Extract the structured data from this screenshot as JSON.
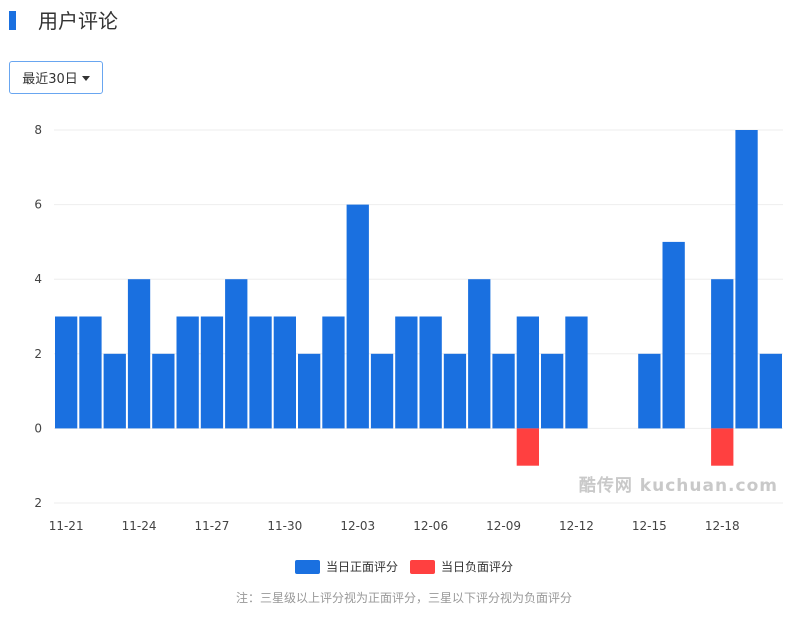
{
  "header": {
    "title": "用户评论"
  },
  "range_button": {
    "label": "最近30日",
    "icon": "caret-down-icon"
  },
  "colors": {
    "accent": "#1a70e0",
    "positive": "#1a70e0",
    "negative": "#ff4040",
    "grid": "#eeeeee"
  },
  "watermark": "酷传网 kuchuan.com",
  "legend": [
    {
      "label": "当日正面评分",
      "color": "#1a70e0"
    },
    {
      "label": "当日负面评分",
      "color": "#ff4040"
    }
  ],
  "note": "注：三星级以上评分视为正面评分，三星以下评分视为负面评分",
  "chart_data": {
    "type": "bar",
    "x": [
      "11-21",
      "11-22",
      "11-23",
      "11-24",
      "11-25",
      "11-26",
      "11-27",
      "11-28",
      "11-29",
      "11-30",
      "12-01",
      "12-02",
      "12-03",
      "12-04",
      "12-05",
      "12-06",
      "12-07",
      "12-08",
      "12-09",
      "12-10",
      "12-11",
      "12-12",
      "12-13",
      "12-14",
      "12-15",
      "12-16",
      "12-17",
      "12-18",
      "12-19",
      "12-20"
    ],
    "x_tick_labels": [
      "11-21",
      "11-24",
      "11-27",
      "11-30",
      "12-03",
      "12-06",
      "12-09",
      "12-12",
      "12-15",
      "12-18"
    ],
    "y_ticks": [
      {
        "value": 8,
        "label": "8"
      },
      {
        "value": 6,
        "label": "6"
      },
      {
        "value": 4,
        "label": "4"
      },
      {
        "value": 2,
        "label": "2"
      },
      {
        "value": 0,
        "label": "0"
      },
      {
        "value": -2,
        "label": "2"
      }
    ],
    "ylim": [
      -2,
      8
    ],
    "series": [
      {
        "name": "当日正面评分",
        "color": "#1a70e0",
        "values": [
          3,
          3,
          2,
          4,
          2,
          3,
          3,
          4,
          3,
          3,
          2,
          3,
          6,
          2,
          3,
          3,
          2,
          4,
          2,
          3,
          2,
          3,
          0,
          0,
          2,
          5,
          0,
          4,
          8,
          2
        ]
      },
      {
        "name": "当日负面评分",
        "color": "#ff4040",
        "values": [
          0,
          0,
          0,
          0,
          0,
          0,
          0,
          0,
          0,
          0,
          0,
          0,
          0,
          0,
          0,
          0,
          0,
          0,
          0,
          -1,
          0,
          0,
          0,
          0,
          0,
          0,
          0,
          -1,
          0,
          0
        ]
      }
    ],
    "grid": true,
    "legend_position": "bottom"
  }
}
